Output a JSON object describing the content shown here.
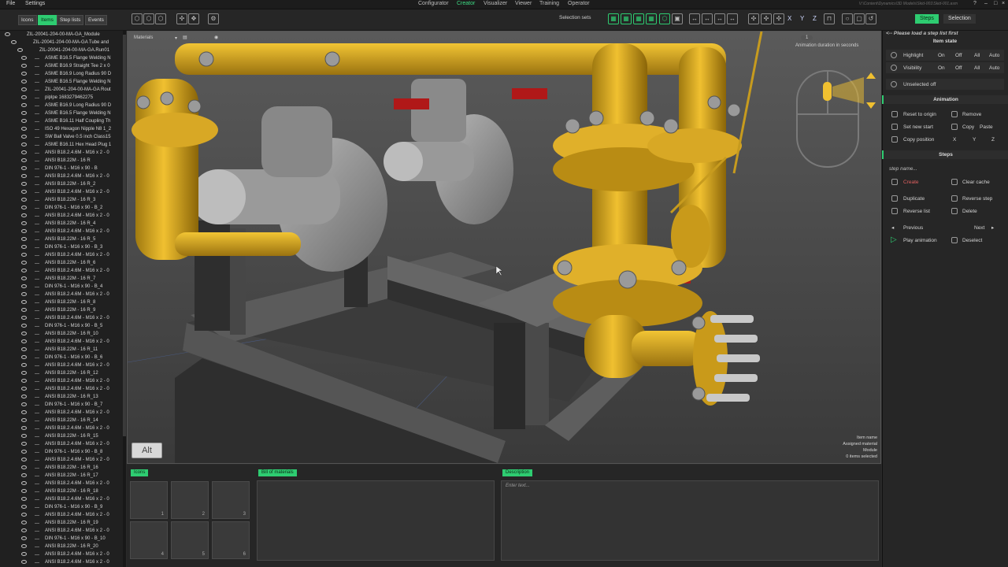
{
  "menu": {
    "file": "File",
    "settings": "Settings"
  },
  "nav": [
    "Configurator",
    "Creator",
    "Visualizer",
    "Viewer",
    "Training",
    "Operator"
  ],
  "nav_active": "Creator",
  "path": "V:\\Content\\Dynamics\\3D Models\\Skid-001\\Skid-001.asm",
  "left_tabs": [
    "Icons",
    "Items",
    "Step lists",
    "Events"
  ],
  "left_tab_active": "Items",
  "selection_sets": "Selection sets",
  "axis_letters": [
    "X",
    "Y",
    "Z"
  ],
  "axis_letters_2": [
    "X",
    "Y",
    "Z"
  ],
  "right_tabs": [
    "Steps",
    "Selection"
  ],
  "tree": {
    "roots": [
      "ZIL-20041-204-00-MA-GA_Module",
      "ZIL-20041-204-00-MA-GA Tube and",
      "ZIL-20041-204-00-MA-GA.Run01"
    ],
    "items": [
      "ASME B16.5 Flange Welding N",
      "ASME B16.9 Straight Tee 2 x 0",
      "ASME B16.9 Long Radius 90 D",
      "ASME B16.5 Flange Welding N",
      "ZIL-20041-204-00-MA-GA Rout",
      "piplpe 1683279462275",
      "ASME B16.9 Long Radius 90 D",
      "ASME B16.5 Flange Welding N",
      "ASME B16.11 Half Coupling Th",
      "ISO 49 Hexagon Nipple N8 1_2",
      "SW Ball Valve 0.5 inch Class15",
      "ASME B16.11 Hex Head Plug 1",
      "ANSI B18.2.4.6M - M16 x 2 - 0",
      "ANSI B18.22M - 16 R",
      "DIN 976-1 - M16 x 90 - B",
      "ANSI B18.2.4.6M - M16 x 2 - 0",
      "ANSI B18.22M - 16 R_2",
      "ANSI B18.2.4.6M - M16 x 2 - 0",
      "ANSI B18.22M - 16 R_3",
      "DIN 976-1 - M16 x 90 - B_2",
      "ANSI B18.2.4.6M - M16 x 2 - 0",
      "ANSI B18.22M - 16 R_4",
      "ANSI B18.2.4.6M - M16 x 2 - 0",
      "ANSI B18.22M - 16 R_5",
      "DIN 976-1 - M16 x 90 - B_3",
      "ANSI B18.2.4.6M - M16 x 2 - 0",
      "ANSI B18.22M - 16 R_6",
      "ANSI B18.2.4.6M - M16 x 2 - 0",
      "ANSI B18.22M - 16 R_7",
      "DIN 976-1 - M16 x 90 - B_4",
      "ANSI B18.2.4.6M - M16 x 2 - 0",
      "ANSI B18.22M - 16 R_8",
      "ANSI B18.22M - 16 R_9",
      "ANSI B18.2.4.6M - M16 x 2 - 0",
      "DIN 976-1 - M16 x 90 - B_5",
      "ANSI B18.22M - 16 R_10",
      "ANSI B18.2.4.6M - M16 x 2 - 0",
      "ANSI B18.22M - 16 R_11",
      "DIN 976-1 - M16 x 90 - B_6",
      "ANSI B18.2.4.6M - M16 x 2 - 0",
      "ANSI B18.22M - 16 R_12",
      "ANSI B18.2.4.6M - M16 x 2 - 0",
      "ANSI B18.2.4.6M - M16 x 2 - 0",
      "ANSI B18.22M - 16 R_13",
      "DIN 976-1 - M16 x 90 - B_7",
      "ANSI B18.2.4.6M - M16 x 2 - 0",
      "ANSI B18.22M - 16 R_14",
      "ANSI B18.2.4.6M - M16 x 2 - 0",
      "ANSI B18.22M - 16 R_15",
      "ANSI B18.2.4.6M - M16 x 2 - 0",
      "DIN 976-1 - M16 x 90 - B_8",
      "ANSI B18.2.4.6M - M16 x 2 - 0",
      "ANSI B18.22M - 16 R_16",
      "ANSI B18.22M - 16 R_17",
      "ANSI B18.2.4.6M - M16 x 2 - 0",
      "ANSI B18.22M - 16 R_18",
      "ANSI B18.2.4.6M - M16 x 2 - 0",
      "DIN 976-1 - M16 x 90 - B_9",
      "ANSI B18.2.4.6M - M16 x 2 - 0",
      "ANSI B18.22M - 16 R_19",
      "ANSI B18.2.4.6M - M16 x 2 - 0",
      "DIN 976-1 - M16 x 90 - B_10",
      "ANSI B18.22M - 16 R_20",
      "ANSI B18.2.4.6M - M16 x 2 - 0",
      "ANSI B18.2.4.6M - M16 x 2 - 0",
      "ANSI B18.22M - 16 R_21",
      "DIN 976-1 - M16 x 90 - B_11"
    ]
  },
  "viewport": {
    "materials": "Materials",
    "anim_duration_label": "Animation duration in seconds",
    "anim_duration_value": "1",
    "alt_button": "Alt",
    "info": [
      "Item name",
      "Assigned material",
      "Module",
      "0 items selected"
    ]
  },
  "bottom": {
    "icons_tag": "Icons",
    "bom_tag": "Bill of materials",
    "desc_tag": "Description",
    "desc_placeholder": "Enter text...",
    "slots": [
      "1",
      "2",
      "3",
      "4",
      "5",
      "6"
    ]
  },
  "right_panel": {
    "load_hint": "<-- Please load a step list first",
    "item_state": "Item state",
    "highlight": "Highlight",
    "visibility": "Visibility",
    "on": "On",
    "off": "Off",
    "all": "All",
    "auto": "Auto",
    "unselected_off": "Unselected off",
    "animation": "Animation",
    "reset_to_origin": "Reset to origin",
    "remove": "Remove",
    "set_new_start": "Set new start",
    "copy": "Copy",
    "paste": "Paste",
    "copy_position": "Copy position",
    "x": "X",
    "y": "Y",
    "z": "Z",
    "steps": "Steps",
    "step_name": "step name...",
    "create": "Create",
    "clear_cache": "Clear cache",
    "duplicate": "Duplicate",
    "reverse_step": "Reverse step",
    "reverse_list": "Reverse list",
    "delete": "Delete",
    "previous": "Previous",
    "next": "Next",
    "play_animation": "Play animation",
    "deselect": "Deselect"
  },
  "colors": {
    "accent": "#2ecc71",
    "pipe": "#d9a921",
    "steel": "#8a8a8a",
    "valve_red": "#b01818"
  }
}
